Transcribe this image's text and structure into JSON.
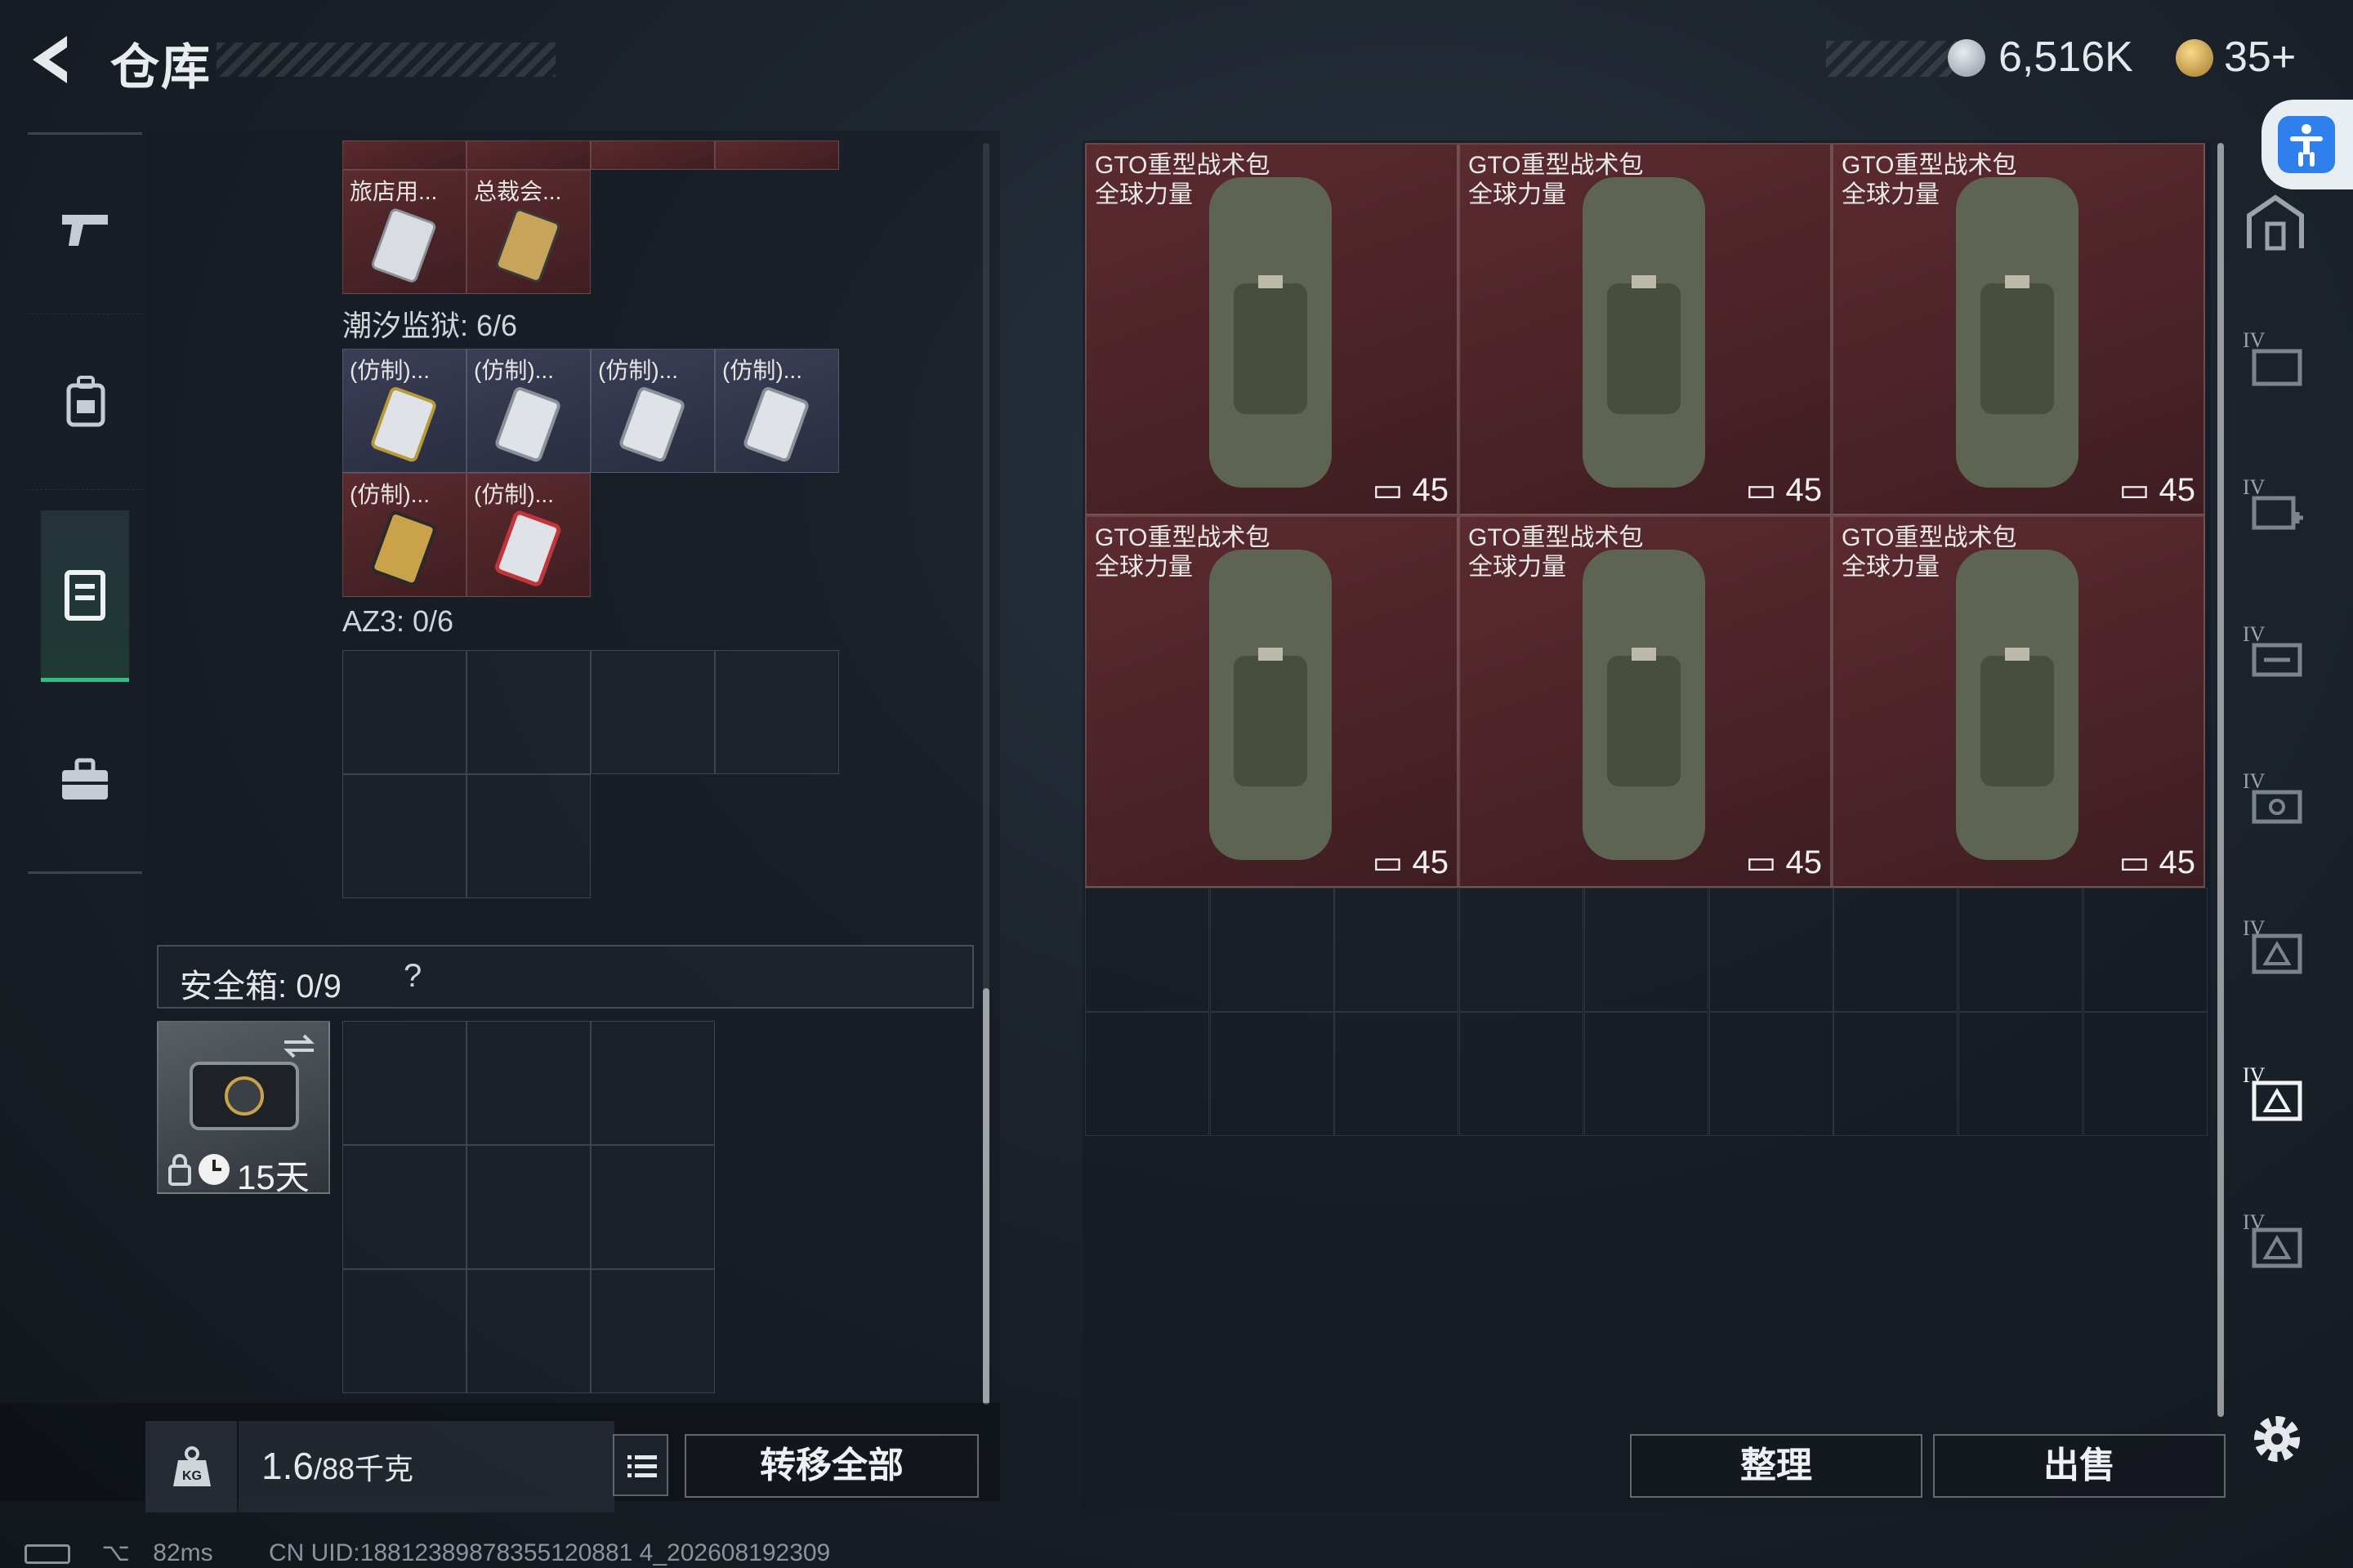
{
  "header": {
    "title": "仓库",
    "currency_primary": "6,516K",
    "currency_secondary": "35+"
  },
  "inventory": {
    "top_row_items": [
      {
        "label": "旅店用..."
      },
      {
        "label": "总裁会..."
      }
    ],
    "section_tide_prison": "潮汐监狱: 6/6",
    "tide_prison_items": [
      {
        "label": "(仿制)..."
      },
      {
        "label": "(仿制)..."
      },
      {
        "label": "(仿制)..."
      },
      {
        "label": "(仿制)..."
      },
      {
        "label": "(仿制)..."
      },
      {
        "label": "(仿制)..."
      }
    ],
    "section_az3": "AZ3: 0/6",
    "safe": {
      "title": "安全箱:  0/9",
      "help": "?",
      "timer": "15天"
    },
    "weight": {
      "current": "1.6",
      "max": "/88千克"
    },
    "transfer_all_label": "转移全部"
  },
  "warehouse": {
    "bags": [
      {
        "name_line1": "GTO重型战术包",
        "name_line2": "全球力量",
        "capacity": "45"
      },
      {
        "name_line1": "GTO重型战术包",
        "name_line2": "全球力量",
        "capacity": "45"
      },
      {
        "name_line1": "GTO重型战术包",
        "name_line2": "全球力量",
        "capacity": "45"
      },
      {
        "name_line1": "GTO重型战术包",
        "name_line2": "全球力量",
        "capacity": "45"
      },
      {
        "name_line1": "GTO重型战术包",
        "name_line2": "全球力量",
        "capacity": "45"
      },
      {
        "name_line1": "GTO重型战术包",
        "name_line2": "全球力量",
        "capacity": "45"
      }
    ],
    "sort_label": "整理",
    "sell_label": "出售",
    "tab_tier_label": "IV"
  },
  "status_bar": {
    "ping": "82ms",
    "uid": "CN UID:18812389878355120881 4_202608192309"
  },
  "colors": {
    "accent_green": "#2fbf84",
    "item_red": "#5a2a2e",
    "item_blue": "#3b3f56",
    "access_blue": "#2f80ed"
  },
  "icons": {
    "back": "back-arrow-icon",
    "coin_silver": "silver-coin-icon",
    "coin_gold": "gold-coin-icon",
    "rail": [
      "pistol-icon",
      "backpack-icon",
      "vest-icon",
      "toolbox-icon"
    ],
    "weight": "kg-weight-icon",
    "list": "list-icon",
    "settings": "gear-icon"
  }
}
